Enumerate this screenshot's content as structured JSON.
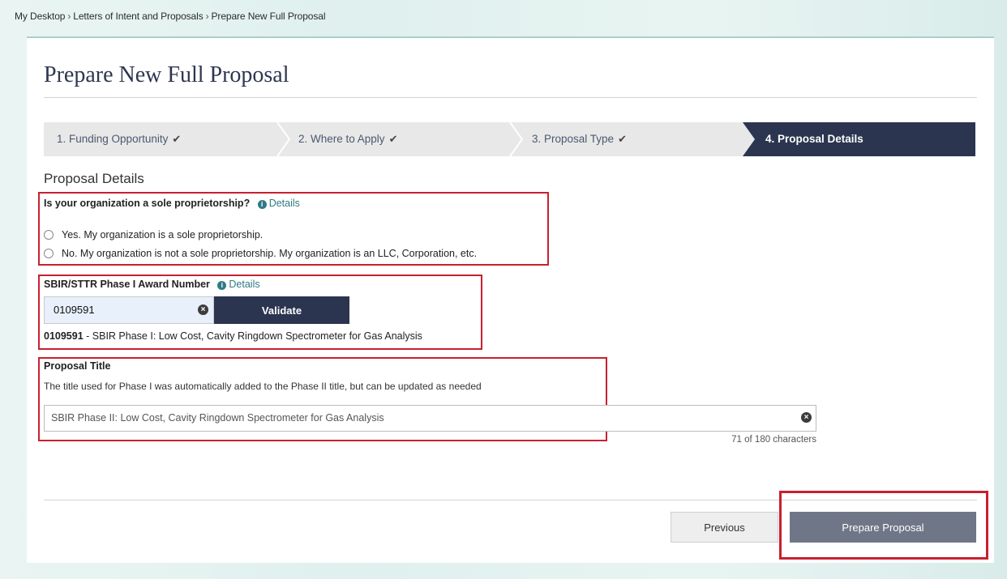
{
  "breadcrumb": [
    "My Desktop",
    "Letters of Intent and Proposals",
    "Prepare New Full Proposal"
  ],
  "page_title": "Prepare New Full Proposal",
  "steps": [
    {
      "label": "1. Funding Opportunity",
      "done": true
    },
    {
      "label": "2. Where to Apply",
      "done": true
    },
    {
      "label": "3. Proposal Type",
      "done": true
    },
    {
      "label": "4. Proposal Details",
      "done": false,
      "active": true
    }
  ],
  "section_heading": "Proposal Details",
  "sole_proprietorship": {
    "question": "Is your organization a sole proprietorship?",
    "details_link": "Details",
    "options": [
      "Yes. My organization is a sole proprietorship.",
      "No. My organization is not a sole proprietorship. My organization is an LLC, Corporation, etc."
    ]
  },
  "award_number": {
    "label": "SBIR/STTR Phase I Award Number",
    "details_link": "Details",
    "value": "0109591",
    "validate_label": "Validate",
    "result_number": "0109591",
    "result_text": " - SBIR Phase I: Low Cost, Cavity Ringdown Spectrometer for Gas Analysis"
  },
  "proposal_title": {
    "label": "Proposal Title",
    "helper": "The title used for Phase I was automatically added to the Phase II title, but can be updated as needed",
    "value": "SBIR Phase II:  Low Cost, Cavity Ringdown Spectrometer for Gas Analysis",
    "char_count": "71 of 180 characters"
  },
  "buttons": {
    "previous": "Previous",
    "prepare": "Prepare Proposal"
  },
  "icons": {
    "check": "check-icon",
    "info": "info-icon",
    "clear": "clear-icon"
  },
  "colors": {
    "highlight": "#c8202f",
    "active_step": "#2b3550",
    "link": "#2e7a85",
    "prepare_button": "#6f7687"
  }
}
